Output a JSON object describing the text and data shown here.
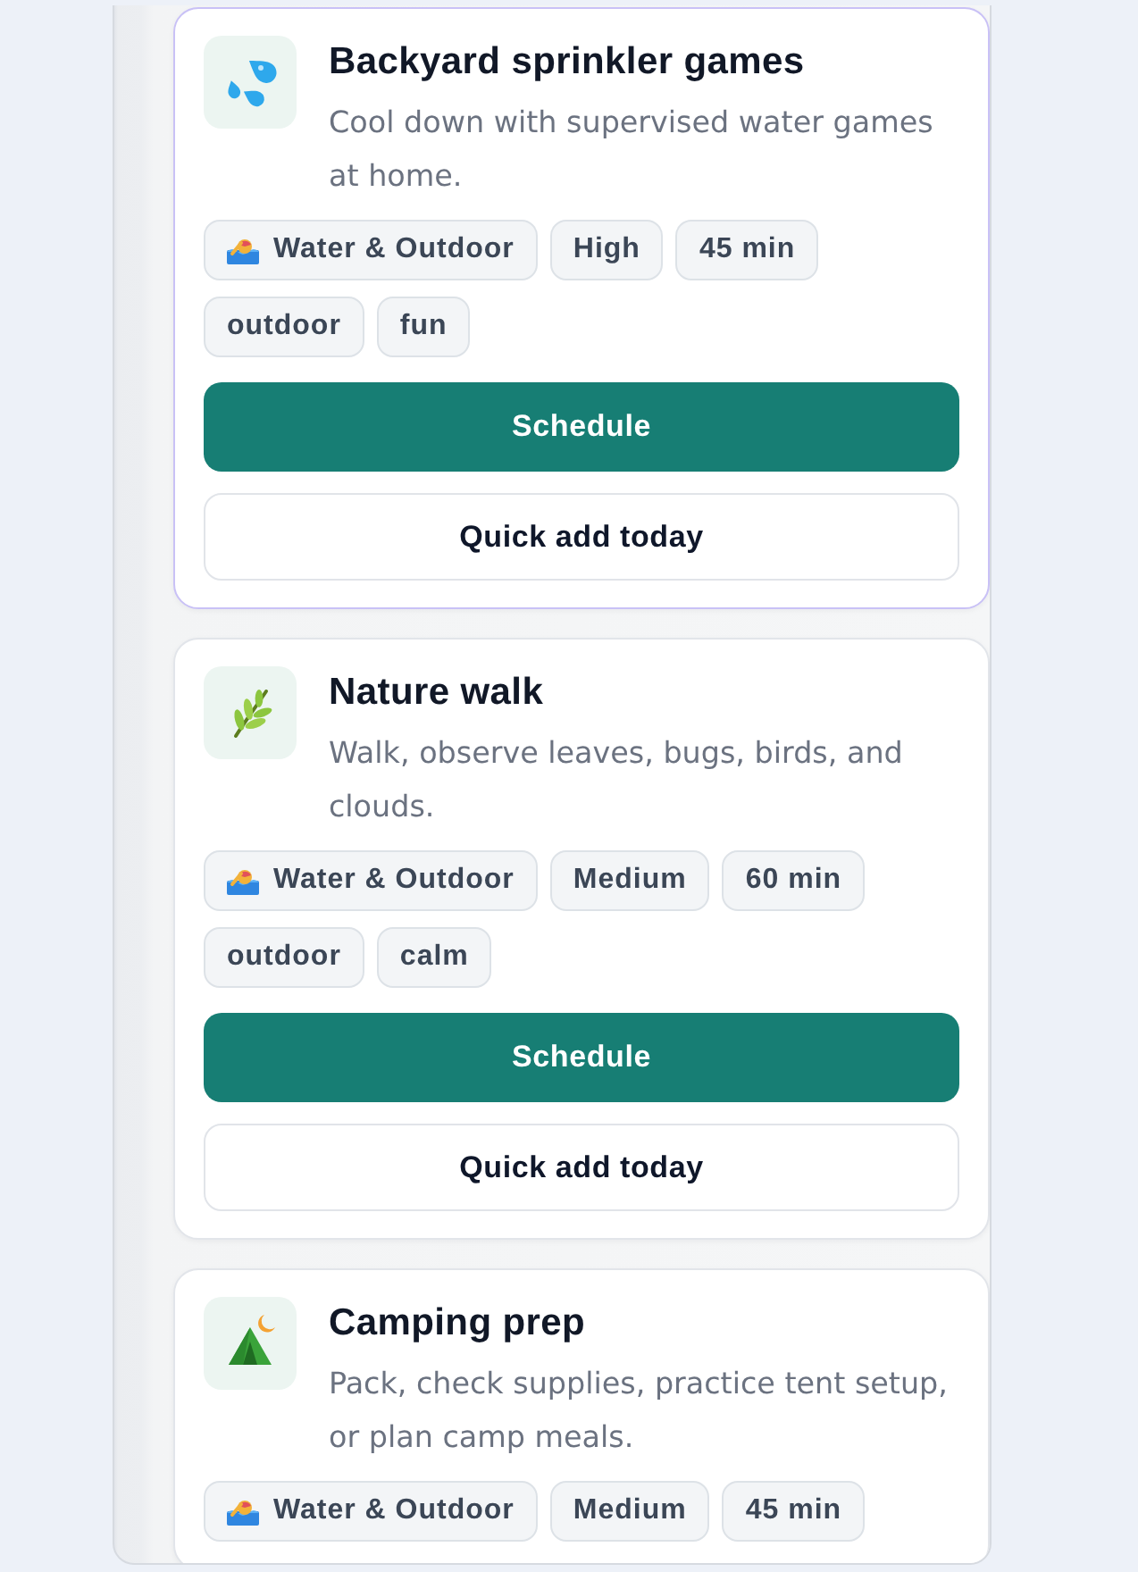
{
  "activities": [
    {
      "title": "Backyard sprinkler games",
      "description": "Cool down with supervised water games at home.",
      "kind": "water",
      "selected": true,
      "chips": [
        {
          "kind": "category",
          "label": "Water & Outdoor"
        },
        {
          "kind": "level",
          "label": "High"
        },
        {
          "kind": "duration",
          "label": "45 min"
        },
        {
          "kind": "tag",
          "label": "outdoor"
        },
        {
          "kind": "tag",
          "label": "fun"
        }
      ],
      "buttons": [
        {
          "kind": "primary",
          "label": "Schedule"
        },
        {
          "kind": "secondary",
          "label": "Quick add today"
        }
      ]
    },
    {
      "title": "Nature walk",
      "description": "Walk, observe leaves, bugs, birds, and clouds.",
      "kind": "nature",
      "selected": false,
      "chips": [
        {
          "kind": "category",
          "label": "Water & Outdoor"
        },
        {
          "kind": "level",
          "label": "Medium"
        },
        {
          "kind": "duration",
          "label": "60 min"
        },
        {
          "kind": "tag",
          "label": "outdoor"
        },
        {
          "kind": "tag",
          "label": "calm"
        }
      ],
      "buttons": [
        {
          "kind": "primary",
          "label": "Schedule"
        },
        {
          "kind": "secondary",
          "label": "Quick add today"
        }
      ]
    },
    {
      "title": "Camping prep",
      "description": "Pack, check supplies, practice tent setup, or plan camp meals.",
      "kind": "camping",
      "selected": false,
      "chips": [
        {
          "kind": "category",
          "label": "Water & Outdoor"
        },
        {
          "kind": "level",
          "label": "Medium"
        },
        {
          "kind": "duration",
          "label": "45 min"
        }
      ]
    }
  ]
}
